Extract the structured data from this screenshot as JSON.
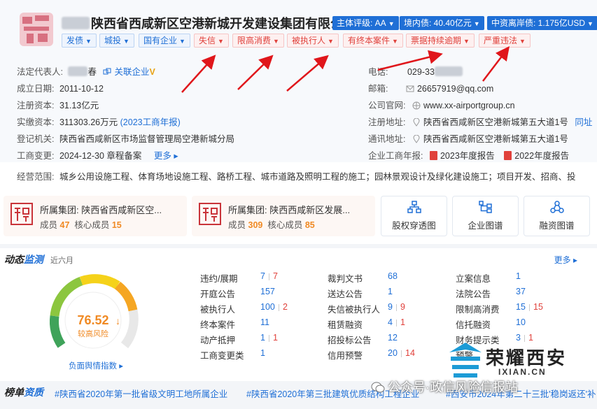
{
  "company": {
    "name": "陕西省西咸新区空港新城开发建设集团有限公司",
    "name_hidden": "陕西",
    "badges": [
      "主体评级: AA",
      "境内债: 40.40亿元",
      "中资离岸债: 1.175亿USD"
    ],
    "blue_tags": [
      "发债",
      "城投",
      "国有企业"
    ],
    "red_tags": [
      "失信",
      "限高消费",
      "被执行人",
      "有终本案件",
      "票据持续逾期",
      "严重违法"
    ]
  },
  "info_left": {
    "legal_rep_label": "法定代表人:",
    "legal_rep_name": "春",
    "related_link": "关联企业",
    "established_label": "成立日期:",
    "established": "2011-10-12",
    "reg_capital_label": "注册资本:",
    "reg_capital": "31.13亿元",
    "paid_capital_label": "实缴资本:",
    "paid_capital": "311303.26万元",
    "paid_capital_link": "(2023工商年报)",
    "authority_label": "登记机关:",
    "authority": "陕西省西咸新区市场监督管理局空港新城分局",
    "change_label": "工商变更:",
    "change_date": "2024-12-30",
    "change_desc": "章程备案",
    "change_more": "更多"
  },
  "info_right": {
    "phone_label": "电话:",
    "phone": "029-33",
    "email_label": "邮箱:",
    "email": "26657919@qq.com",
    "website_label": "公司官网:",
    "website": "www.xx-airportgroup.cn",
    "reg_addr_label": "注册地址:",
    "reg_addr": "陕西省西咸新区空港新城第五大道1号",
    "reg_addr_link": "同址",
    "mail_addr_label": "通讯地址:",
    "mail_addr": "陕西省西咸新区空港新城第五大道1号",
    "report_label": "企业工商年报:",
    "report_2023": "2023年度报告",
    "report_2022": "2022年度报告"
  },
  "scope": {
    "label": "经营范围:",
    "text": "城乡公用设施工程、体育场地设施工程、路桥工程、城市道路及照明工程的施工；园林景观设计及绿化建设施工；项目开发、招商、投"
  },
  "groups": [
    {
      "title": "所属集团: 陕西省西咸新区空...",
      "members_label": "成员",
      "members": "47",
      "core_label": "核心成员",
      "core": "15"
    },
    {
      "title": "所属集团: 陕西西咸新区发展...",
      "members_label": "成员",
      "members": "309",
      "core_label": "核心成员",
      "core": "85"
    }
  ],
  "shortcuts": [
    "股权穿透图",
    "企业图谱",
    "融资图谱"
  ],
  "dynamic": {
    "title_a": "动态",
    "title_b": "监测",
    "subtitle": "近六月",
    "more": "更多",
    "score": "76.52",
    "score_arrow": "↓",
    "risk_level": "较高风险",
    "sentiment_link": "负面舆情指数"
  },
  "stats": [
    {
      "label": "违约/展期",
      "value": "7",
      "red": "7"
    },
    {
      "label": "开庭公告",
      "value": "157",
      "red": ""
    },
    {
      "label": "被执行人",
      "value": "100",
      "red": "2"
    },
    {
      "label": "终本案件",
      "value": "11",
      "red": ""
    },
    {
      "label": "动产抵押",
      "value": "1",
      "red": "1"
    },
    {
      "label": "工商变更类",
      "value": "1",
      "red": ""
    },
    {
      "label": "裁判文书",
      "value": "68",
      "red": ""
    },
    {
      "label": "送达公告",
      "value": "1",
      "red": ""
    },
    {
      "label": "失信被执行人",
      "value": "9",
      "red": "9"
    },
    {
      "label": "租赁融资",
      "value": "4",
      "red": "1"
    },
    {
      "label": "招投标公告",
      "value": "12",
      "red": ""
    },
    {
      "label": "信用预警",
      "value": "20",
      "red": "14"
    },
    {
      "label": "立案信息",
      "value": "1",
      "red": ""
    },
    {
      "label": "法院公告",
      "value": "37",
      "red": ""
    },
    {
      "label": "限制高消费",
      "value": "15",
      "red": "15"
    },
    {
      "label": "信托融资",
      "value": "10",
      "red": ""
    },
    {
      "label": "财务提示类",
      "value": "3",
      "red": "1"
    },
    {
      "label": "预警",
      "value": "",
      "red": ""
    }
  ],
  "ranking": {
    "title_a": "榜单",
    "title_b": "资质",
    "items": [
      "#陕西省2020年第一批省级文明工地所属企业",
      "#陕西省2020年第三批建筑优质结构工程企业",
      "#西安市2024年第二十三批'稳岗返还'补"
    ]
  },
  "watermark": {
    "brand": "荣耀西安",
    "url": "IXIAN.CN",
    "wechat": "公众号·政信风险信报站"
  },
  "colors": {
    "accent": "#1f6fd6",
    "danger": "#e0413b",
    "warning": "#f08a24"
  }
}
